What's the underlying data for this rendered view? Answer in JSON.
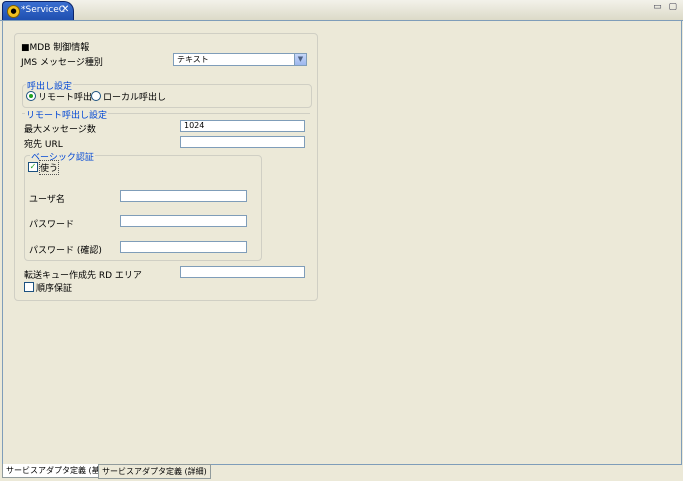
{
  "tab": {
    "title": "*ServiceC",
    "close": "✕",
    "icon": "●"
  },
  "window_controls": "▭ ▢",
  "mdb_section": {
    "title": "■MDB 制御情報"
  },
  "jms": {
    "label": "JMS メッセージ種別",
    "value": "テキスト",
    "arrow": "▼"
  },
  "call_setting": {
    "title": "呼出し設定",
    "remote": "リモート呼出し",
    "local": "ローカル呼出し"
  },
  "remote_setting": {
    "title": "リモート呼出し設定",
    "max_msg_label": "最大メッセージ数",
    "max_msg_value": "1024",
    "dest_url_label": "宛先 URL",
    "dest_url_value": ""
  },
  "basic_auth": {
    "title": "ベーシック認証",
    "use_label": "使う",
    "user_label": "ユーザ名",
    "password_label": "パスワード",
    "password_confirm_label": "パスワード (確認)"
  },
  "transfer_queue_label": "転送キュー作成先 RD エリア",
  "order_guarantee_label": "順序保証",
  "bottom_tabs": [
    "サービスアダプタ定義 (基本)",
    "サービスアダプタ定義 (詳細)"
  ]
}
